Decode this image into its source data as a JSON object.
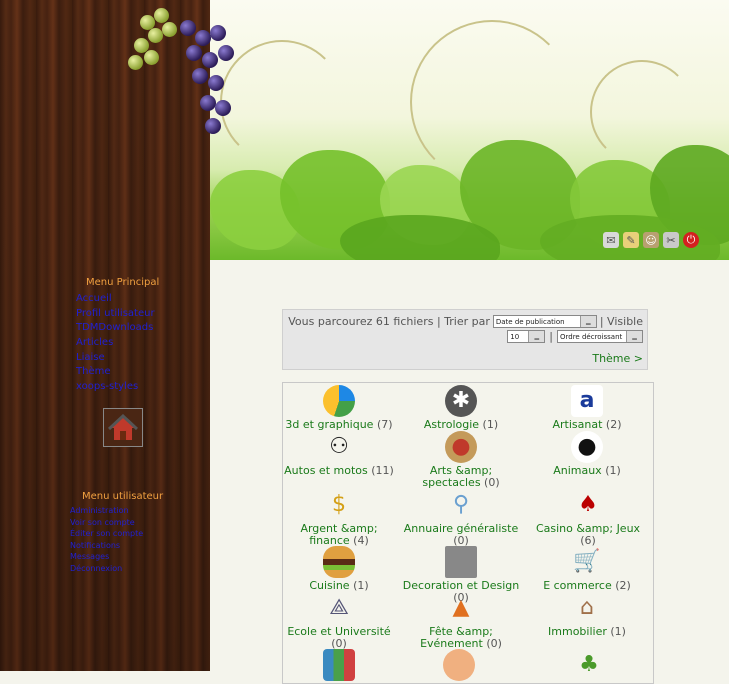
{
  "sidebar": {
    "main_menu_title": "Menu Principal",
    "main_menu": [
      "Accueil",
      "Profil utilisateur",
      "TDMDownloads",
      "Articles",
      "Liaise",
      "Thème",
      "xoops-styles"
    ],
    "user_menu_title": "Menu utilisateur",
    "user_menu": [
      "Administration",
      "Voir son compte",
      "Éditer son compte",
      "Notifications",
      "Messages",
      "Déconnexion"
    ],
    "home_icon": "house-icon"
  },
  "toolbar": {
    "icons": [
      "mail-icon",
      "edit-icon",
      "users-icon",
      "tools-icon",
      "power-icon"
    ]
  },
  "sortbar": {
    "browse_text": "Vous parcourez 61 fichiers | Trier par",
    "sort_value": "Date de publication",
    "visible_text": "| Visible",
    "limit_value": "10",
    "separator": "|",
    "order_value": "Ordre décroissant",
    "theme_link": "Thème >"
  },
  "categories": [
    {
      "name": "3d et graphique",
      "count": "(7)",
      "icon": "pie-chart-icon"
    },
    {
      "name": "Astrologie",
      "count": "(1)",
      "icon": "spider-icon"
    },
    {
      "name": "Artisanat",
      "count": "(2)",
      "icon": "artisan-logo-icon"
    },
    {
      "name": "Autos et motos",
      "count": "(11)",
      "icon": "motorbike-icon"
    },
    {
      "name": "Arts &amp; spectacles",
      "count": "(0)",
      "icon": "palette-icon"
    },
    {
      "name": "Animaux",
      "count": "(1)",
      "icon": "panda-icon"
    },
    {
      "name": "Argent &amp; finance",
      "count": "(4)",
      "icon": "money-icon"
    },
    {
      "name": "Annuaire généraliste",
      "count": "(0)",
      "icon": "magnifier-icon"
    },
    {
      "name": "Casino &amp; Jeux",
      "count": "(6)",
      "icon": "cards-icon"
    },
    {
      "name": "Cuisine",
      "count": "(1)",
      "icon": "burger-icon"
    },
    {
      "name": "Decoration et Design",
      "count": "(0)",
      "icon": "furniture-icon"
    },
    {
      "name": "E commerce",
      "count": "(2)",
      "icon": "cart-icon"
    },
    {
      "name": "Ecole et Université",
      "count": "(0)",
      "icon": "compass-icon"
    },
    {
      "name": "Fête &amp; Evénement",
      "count": "(0)",
      "icon": "party-icon"
    },
    {
      "name": "Immobilier",
      "count": "(1)",
      "icon": "house-icon"
    },
    {
      "name": "",
      "count": "",
      "icon": "books-icon"
    },
    {
      "name": "",
      "count": "",
      "icon": "girl-icon"
    },
    {
      "name": "",
      "count": "",
      "icon": "plant-icon"
    }
  ],
  "colors": {
    "link": "#1a7a1a",
    "menu_title": "#f0a040",
    "menu_link": "#2020d0"
  }
}
